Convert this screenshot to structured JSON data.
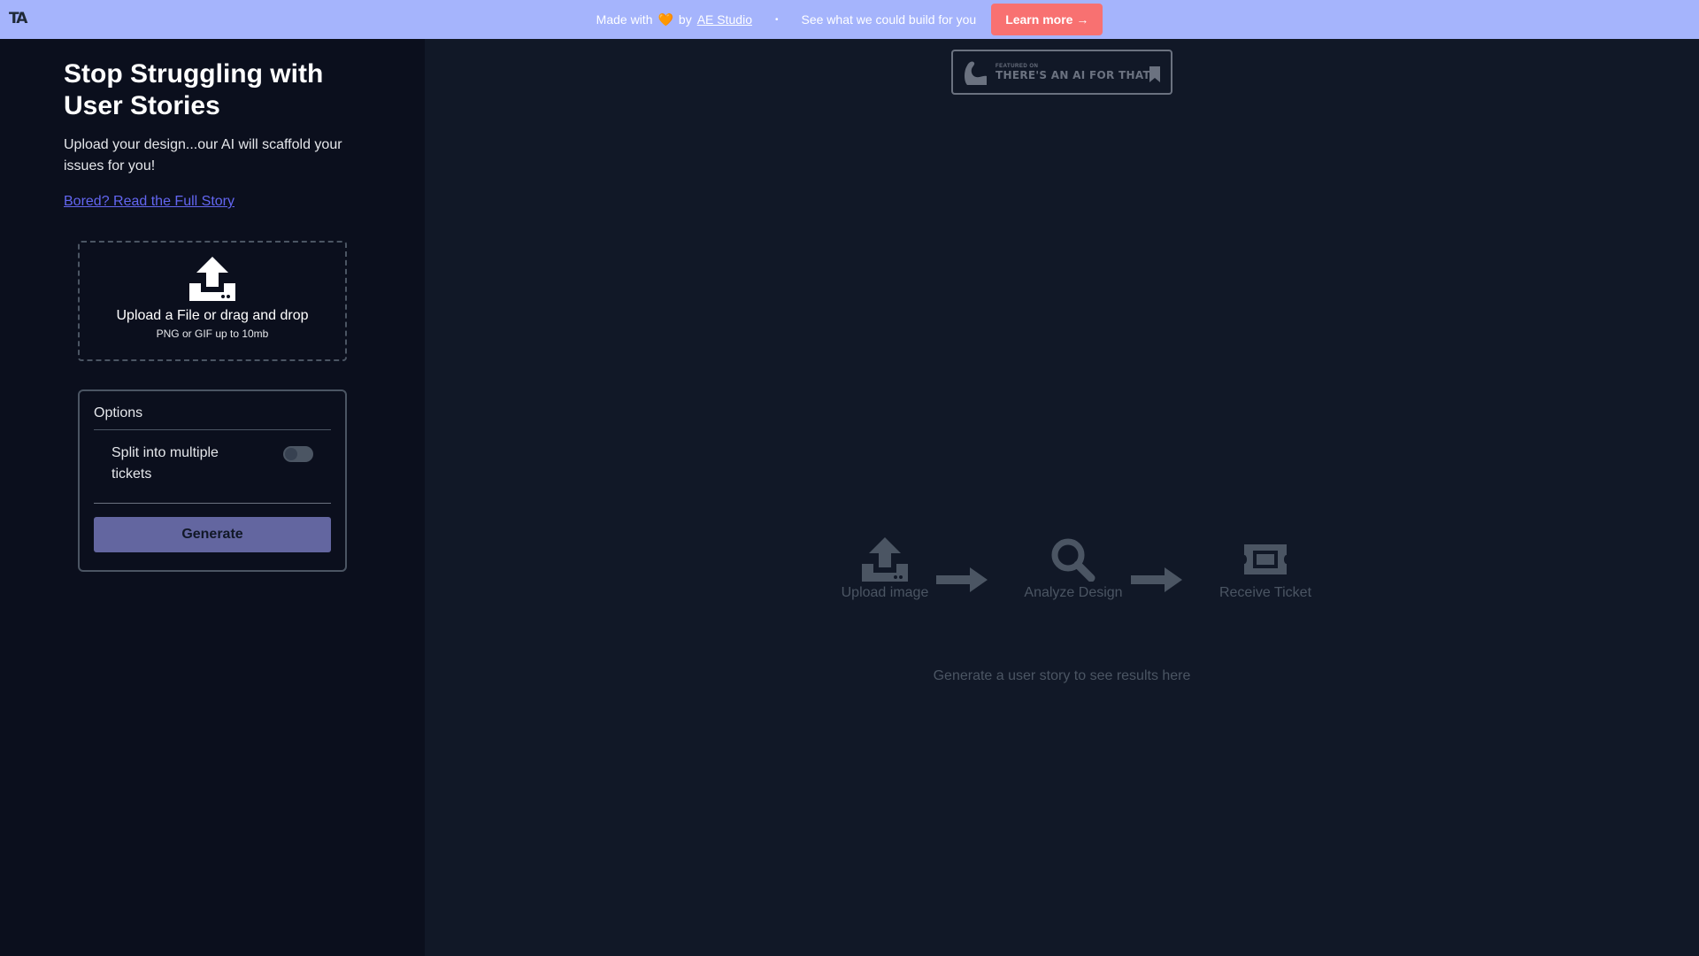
{
  "banner": {
    "logo": "TA",
    "made_with": "Made with",
    "heart": "🧡",
    "by": "by",
    "studio_link": "AE Studio",
    "separator": "•",
    "tagline": "See what we could build for you",
    "cta": "Learn more →"
  },
  "sidebar": {
    "title": "Stop Struggling with User Stories",
    "subtitle": "Upload your design...our AI will scaffold your issues for you!",
    "story_link": "Bored? Read the Full Story",
    "dropzone": {
      "title": "Upload a File or drag and drop",
      "hint": "PNG or GIF up to 10mb"
    },
    "options": {
      "label": "Options",
      "split_label": "Split into multiple tickets",
      "split_enabled": false,
      "generate": "Generate"
    }
  },
  "main": {
    "badge": {
      "small": "FEATURED ON",
      "big": "THERE'S AN AI FOR THAT"
    },
    "steps": [
      {
        "label": "Upload image",
        "icon": "upload-icon"
      },
      {
        "label": "Analyze Design",
        "icon": "magnifier-icon"
      },
      {
        "label": "Receive Ticket",
        "icon": "ticket-icon"
      }
    ],
    "empty_message": "Generate a user story to see results here"
  },
  "colors": {
    "banner_bg": "#a5b4fc",
    "cta_bg": "#f87171",
    "sidebar_bg": "#0b0f1d",
    "main_bg": "#111827",
    "link": "#6366f1",
    "generate_bg": "#6366a0",
    "muted": "#4b5563"
  }
}
